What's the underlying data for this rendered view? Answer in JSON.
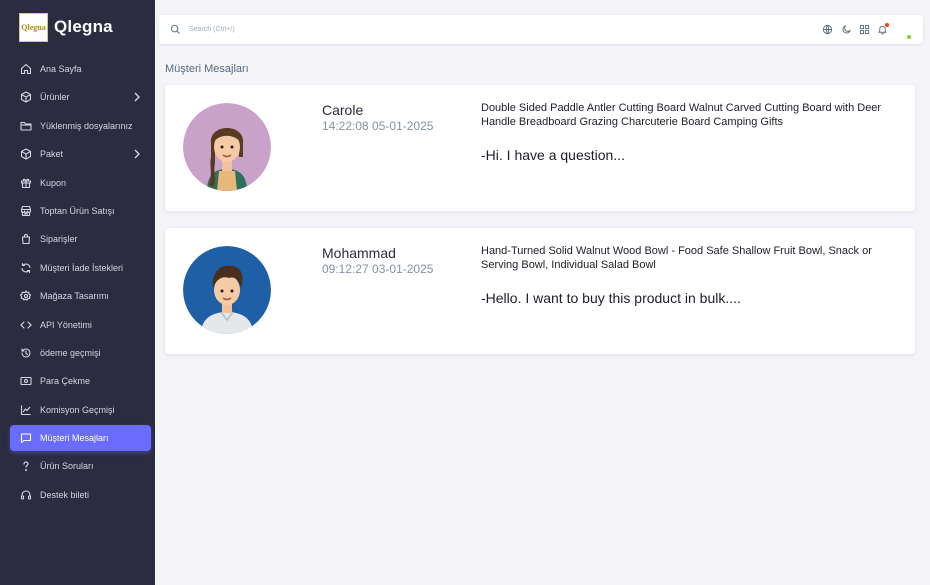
{
  "brand": {
    "name": "Qlegna",
    "logo_text": "Qlegna"
  },
  "sidebar": {
    "items": [
      {
        "label": "Ana Sayfa",
        "icon": "home-icon",
        "has_children": false,
        "active": false
      },
      {
        "label": "Ürünler",
        "icon": "box-icon",
        "has_children": true,
        "active": false
      },
      {
        "label": "Yüklenmiş dosyalarınız",
        "icon": "folder-icon",
        "has_children": false,
        "active": false
      },
      {
        "label": "Paket",
        "icon": "package-icon",
        "has_children": true,
        "active": false
      },
      {
        "label": "Kupon",
        "icon": "gift-icon",
        "has_children": false,
        "active": false
      },
      {
        "label": "Toptan Ürün Satışı",
        "icon": "store-icon",
        "has_children": false,
        "active": false
      },
      {
        "label": "Siparişler",
        "icon": "shopping-bag-icon",
        "has_children": false,
        "active": false
      },
      {
        "label": "Müşteri İade İstekleri",
        "icon": "refresh-icon",
        "has_children": false,
        "active": false
      },
      {
        "label": "Mağaza Tasarımı",
        "icon": "settings-icon",
        "has_children": false,
        "active": false
      },
      {
        "label": "API Yönetimi",
        "icon": "code-icon",
        "has_children": false,
        "active": false
      },
      {
        "label": "ödeme geçmişi",
        "icon": "history-icon",
        "has_children": false,
        "active": false
      },
      {
        "label": "Para Çekme",
        "icon": "cash-icon",
        "has_children": false,
        "active": false
      },
      {
        "label": "Komisyon Geçmişi",
        "icon": "line-chart-icon",
        "has_children": false,
        "active": false
      },
      {
        "label": "Müşteri Mesajları",
        "icon": "message-icon",
        "has_children": false,
        "active": true
      },
      {
        "label": "Ürün Soruları",
        "icon": "question-icon",
        "has_children": false,
        "active": false
      },
      {
        "label": "Destek bileti",
        "icon": "headset-icon",
        "has_children": false,
        "active": false
      }
    ]
  },
  "topbar": {
    "search_placeholder": "Search (Ctrl+/)",
    "icons": [
      "globe-icon",
      "moon-icon",
      "apps-grid-icon",
      "bell-icon"
    ]
  },
  "page": {
    "title": "Müşteri Mesajları"
  },
  "messages": [
    {
      "name": "Carole",
      "timestamp": "14:22:08 05-01-2025",
      "product": "Double Sided Paddle Antler Cutting Board Walnut Carved Cutting Board with Deer Handle Breadboard Grazing Charcuterie Board Camping Gifts",
      "message": "-Hi. I have a question..."
    },
    {
      "name": "Mohammad",
      "timestamp": "09:12:27 03-01-2025",
      "product": "Hand-Turned Solid Walnut Wood Bowl - Food Safe Shallow Fruit Bowl, Snack or Serving Bowl, Individual Salad Bowl",
      "message": "-Hello. I want to buy this product in bulk...."
    }
  ],
  "colors": {
    "sidebar_bg": "#2b2c40",
    "accent": "#696cff",
    "page_bg": "#f5f5f9",
    "notification": "#ff3e1d",
    "online": "#71dd37"
  }
}
